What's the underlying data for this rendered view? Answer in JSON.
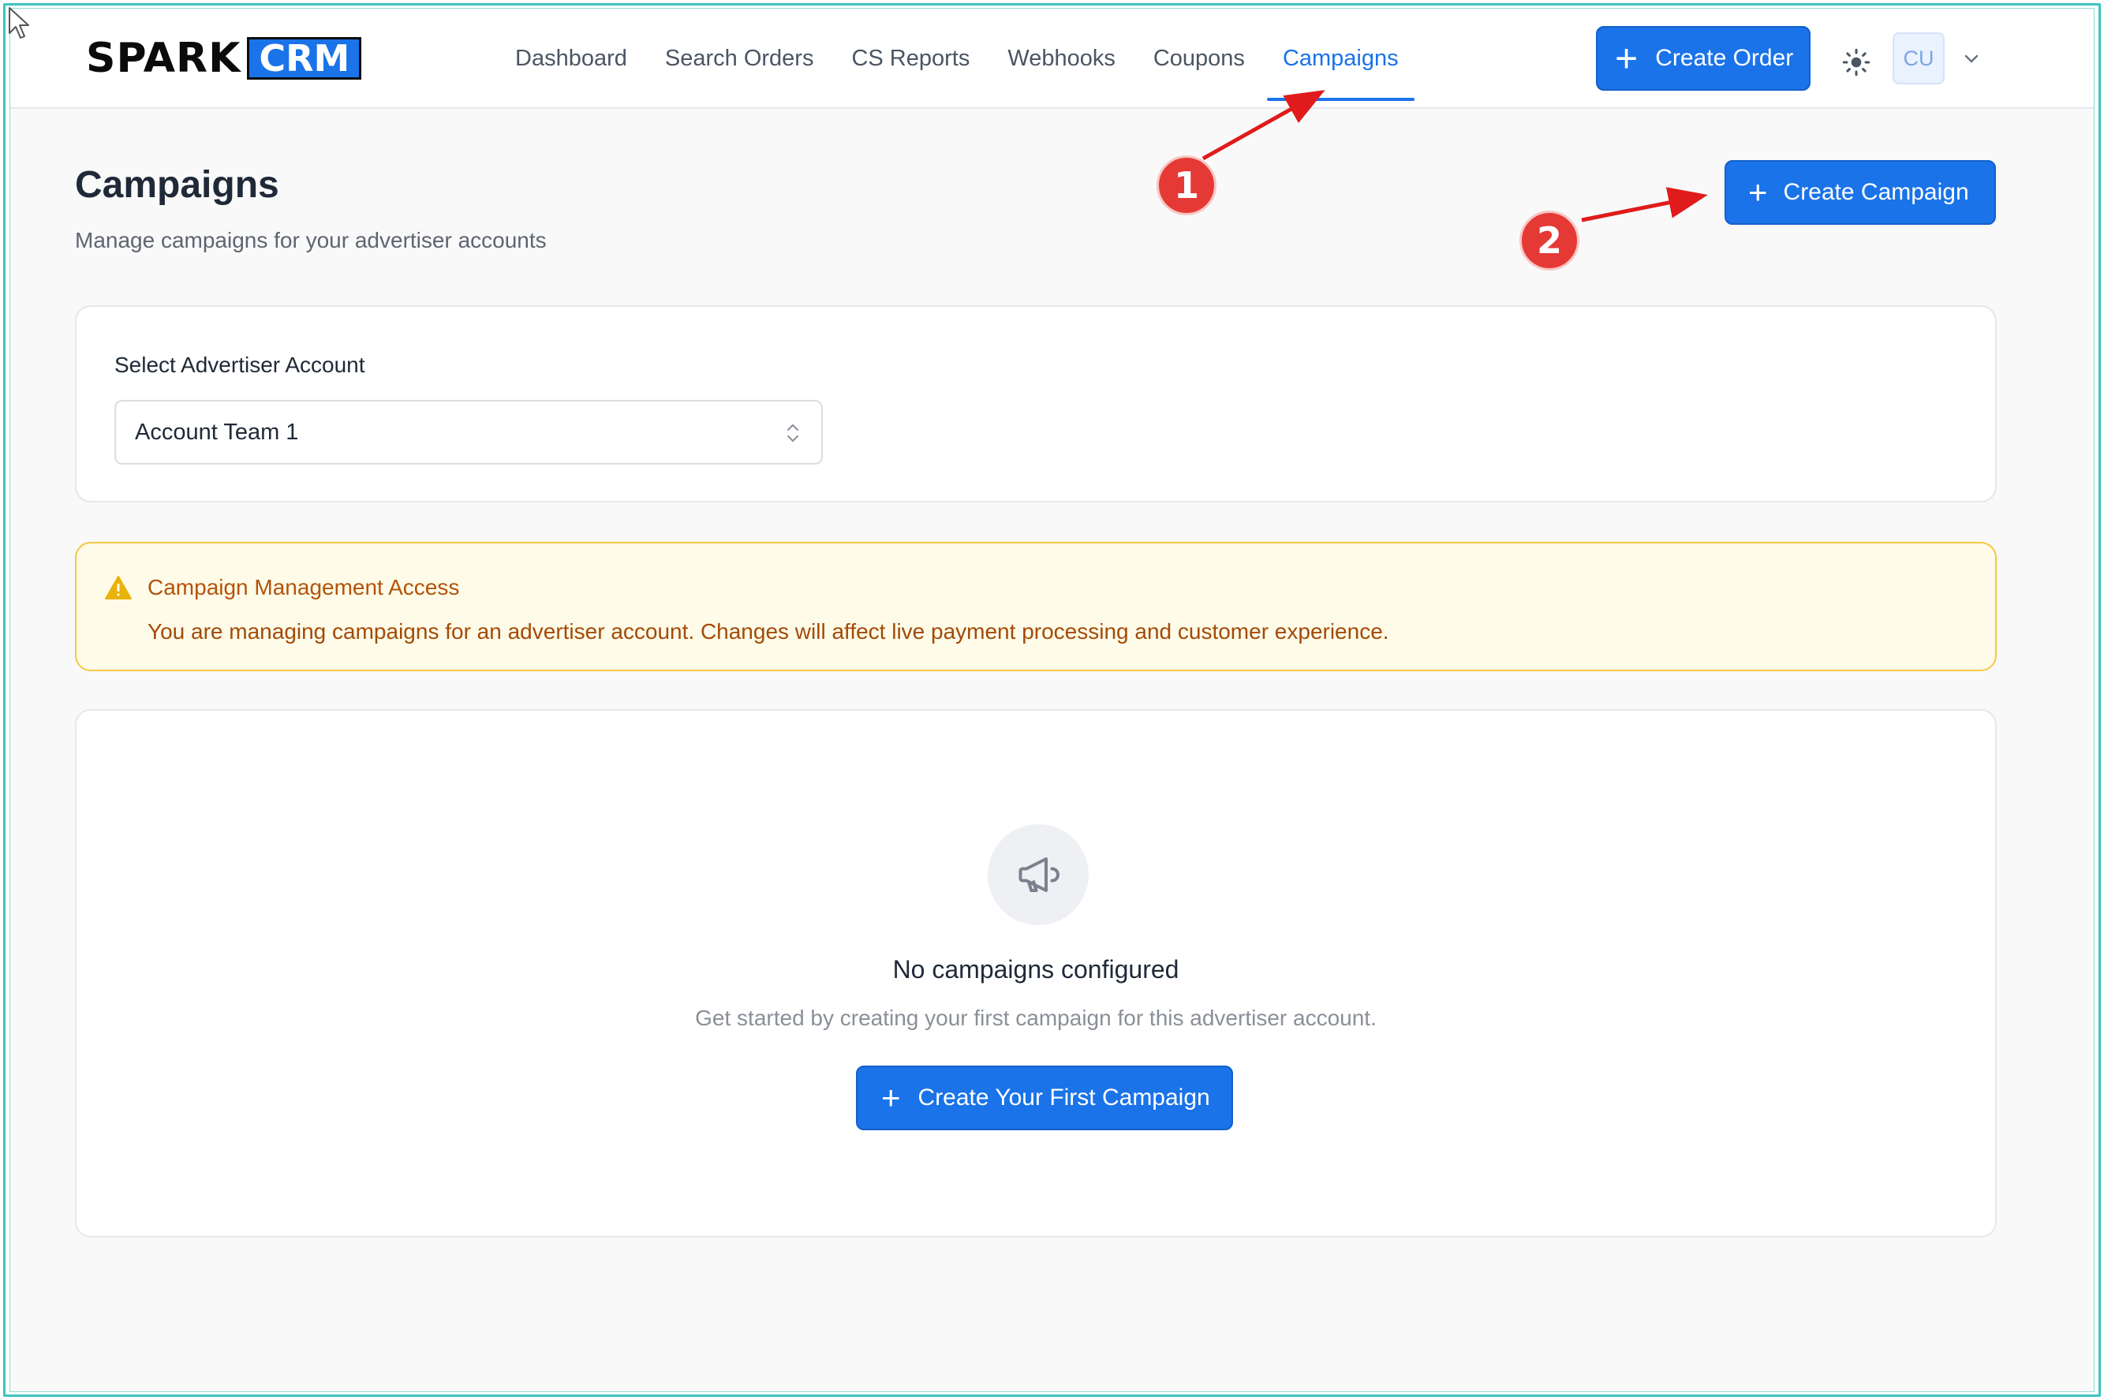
{
  "header": {
    "logo_spark": "SPARK",
    "logo_crm": "CRM",
    "nav": [
      {
        "label": "Dashboard"
      },
      {
        "label": "Search Orders"
      },
      {
        "label": "CS Reports"
      },
      {
        "label": "Webhooks"
      },
      {
        "label": "Coupons"
      },
      {
        "label": "Campaigns",
        "active": true
      }
    ],
    "create_order_label": "Create Order",
    "avatar_initials": "CU"
  },
  "page": {
    "title": "Campaigns",
    "subtitle": "Manage campaigns for your advertiser accounts",
    "create_campaign_label": "Create Campaign"
  },
  "annotations": {
    "badge_1": "1",
    "badge_2": "2"
  },
  "account": {
    "label": "Select Advertiser Account",
    "selected": "Account Team 1"
  },
  "warning": {
    "title": "Campaign Management Access",
    "text": "You are managing campaigns for an advertiser account. Changes will affect live payment processing and customer experience."
  },
  "empty_state": {
    "title": "No campaigns configured",
    "text": "Get started by creating your first campaign for this advertiser account.",
    "button_label": "Create Your First Campaign"
  },
  "icons": {
    "cursor": "mouse-pointer-icon",
    "theme": "sun-icon",
    "chevron": "chevron-down-icon",
    "select": "select-arrows-icon",
    "warning": "warning-triangle-icon",
    "empty": "megaphone-icon"
  },
  "colors": {
    "accent": "#1a73e8",
    "warning_bg": "#fefbe8",
    "warning_border": "#f5c842",
    "warning_text": "#b45309",
    "annotation": "#e53935",
    "frame": "#3cc4c0"
  }
}
